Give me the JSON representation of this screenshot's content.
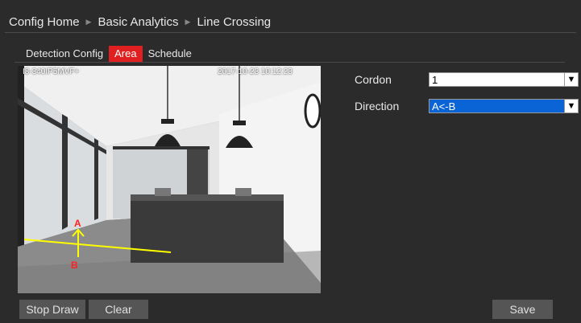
{
  "breadcrumb": {
    "items": [
      "Config Home",
      "Basic Analytics",
      "Line Crossing"
    ],
    "separator": "▶"
  },
  "tabs": [
    {
      "label": "Detection Config",
      "active": false
    },
    {
      "label": "Area",
      "active": true
    },
    {
      "label": "Schedule",
      "active": false
    }
  ],
  "video": {
    "camera_name": "I8-340IP5MVF+",
    "timestamp": "2017-10-23  10:12:23",
    "point_a": "A",
    "point_b": "B"
  },
  "form": {
    "cordon_label": "Cordon",
    "cordon_value": "1",
    "direction_label": "Direction",
    "direction_value": "A<-B"
  },
  "buttons": {
    "stop_draw": "Stop Draw",
    "clear": "Clear",
    "save": "Save"
  },
  "colors": {
    "accent": "#e02020",
    "background": "#2b2b2b",
    "selection": "#0a64d6",
    "line": "#ffff00"
  },
  "icons": [
    "triangle-separator-icon",
    "dropdown-arrow-icon"
  ]
}
